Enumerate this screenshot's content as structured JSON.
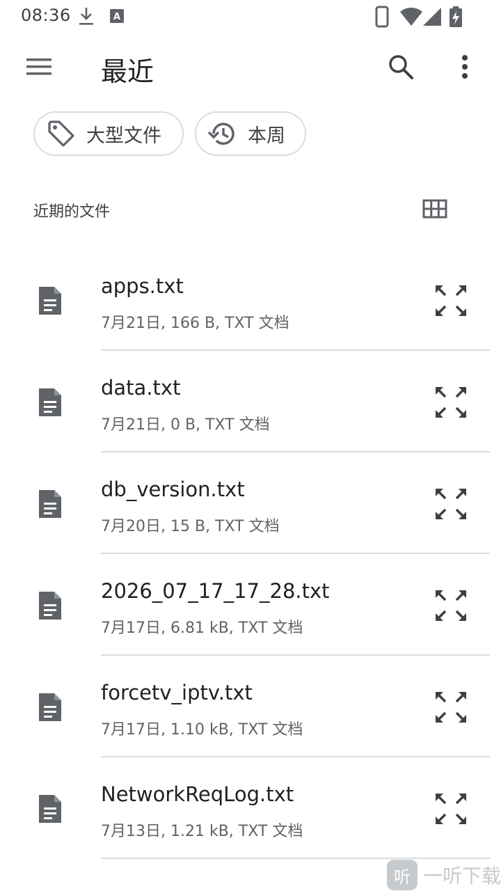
{
  "status_bar": {
    "time": "08:36",
    "icons": [
      "download-icon",
      "keyboard-a-icon",
      "phone-icon",
      "wifi-icon",
      "signal-icon",
      "battery-charging-icon"
    ]
  },
  "app_bar": {
    "title": "最近",
    "icons": [
      "menu-icon",
      "search-icon",
      "more-vert-icon"
    ]
  },
  "chips": [
    {
      "label": "大型文件",
      "icon": "tag-icon"
    },
    {
      "label": "本周",
      "icon": "history-icon"
    }
  ],
  "section": {
    "title": "近期的文件",
    "view_toggle_icon": "grid-view-icon"
  },
  "files": [
    {
      "name": "apps.txt",
      "meta": "7月21日, 166 B, TXT 文档"
    },
    {
      "name": "data.txt",
      "meta": "7月21日, 0 B, TXT 文档"
    },
    {
      "name": "db_version.txt",
      "meta": "7月20日, 15 B, TXT 文档"
    },
    {
      "name": "2026_07_17_17_28.txt",
      "meta": "7月17日, 6.81 kB, TXT 文档"
    },
    {
      "name": "forcetv_iptv.txt",
      "meta": "7月17日, 1.10 kB, TXT 文档"
    },
    {
      "name": "NetworkReqLog.txt",
      "meta": "7月13日, 1.21 kB, TXT 文档"
    }
  ],
  "watermark": {
    "badge": "听",
    "text": "一听下载"
  },
  "colors": {
    "icon_gray": "#5f6368",
    "text_primary": "#202124",
    "divider": "#dadce0"
  }
}
